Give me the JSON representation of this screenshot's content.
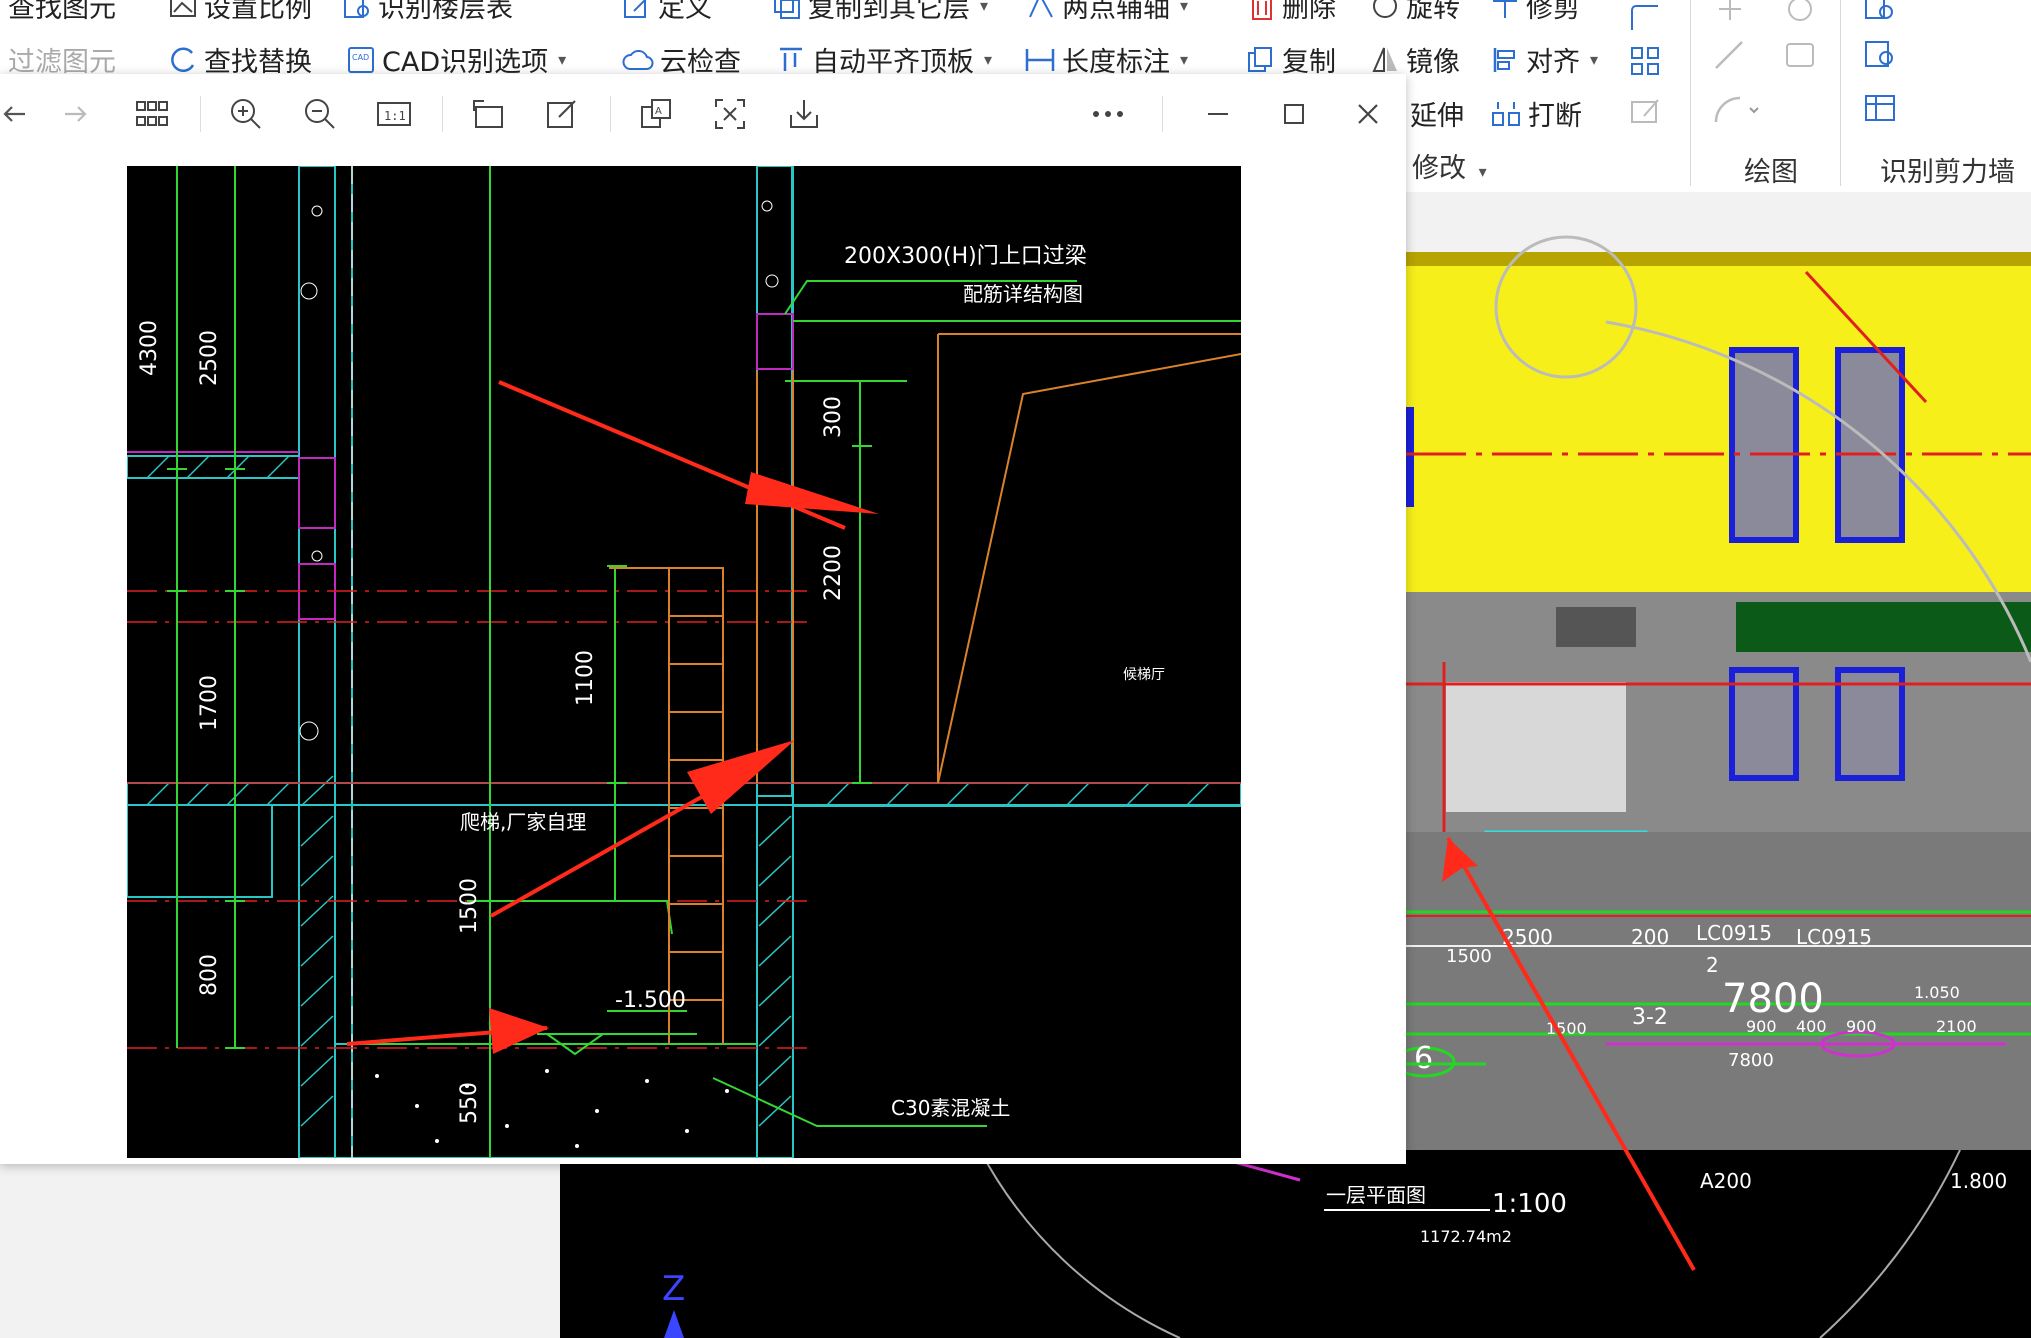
{
  "ribbon": {
    "row1": [
      "查找图元",
      "设置比例",
      "识别楼层表",
      "定义",
      "复制到其它层",
      "两点辅轴",
      "删除",
      "旋转",
      "修剪"
    ],
    "row2": [
      "过滤图元",
      "查找替换",
      "CAD识别选项",
      "云检查",
      "自动平齐顶板",
      "长度标注",
      "复制",
      "镜像",
      "对齐"
    ],
    "row3": [
      "延伸",
      "打断"
    ],
    "groups": {
      "modify": "修改",
      "draw": "绘图",
      "recognize": "识别剪力墙"
    }
  },
  "viewer": {
    "toolbar_icons": [
      "back-icon",
      "forward-icon",
      "grid-view-icon",
      "zoom-in-icon",
      "zoom-out-icon",
      "actual-size-icon",
      "rotate-icon",
      "edit-icon",
      "translate-icon",
      "ocr-icon",
      "download-icon",
      "more-icon",
      "minimize-icon",
      "maximize-icon",
      "close-icon"
    ],
    "drawing": {
      "labels": {
        "beam": "200X300(H)门上口过梁",
        "beam_sub": "配筋详结构图",
        "ladder": "爬梯,厂家自理",
        "elevation": "-1.500",
        "concrete": "C30素混凝土",
        "room": "候梯厅"
      },
      "dims": [
        "4300",
        "2500",
        "1700",
        "800",
        "300",
        "2200",
        "1100",
        "1500",
        "550"
      ]
    }
  },
  "background_plan": {
    "texts": [
      "2500",
      "200",
      "LC0915",
      "LC0915",
      "1500",
      "2",
      "7800",
      "1.050",
      "3-2",
      "1500",
      "900",
      "400",
      "900",
      "2100",
      "7800",
      "6"
    ],
    "title": "一层平面图",
    "scale": "1:100",
    "area": "1172.74m2",
    "note": "A200",
    "note_value": "1.800",
    "axis_label": "Z"
  },
  "colors": {
    "arrow": "#ff2a1a",
    "cad_green": "#33d633",
    "cad_cyan": "#29c6c6",
    "cad_orange": "#d9822b",
    "cad_magenta": "#c02ac0",
    "cad_red": "#e02020",
    "wall_yellow": "#f7ef1a"
  }
}
